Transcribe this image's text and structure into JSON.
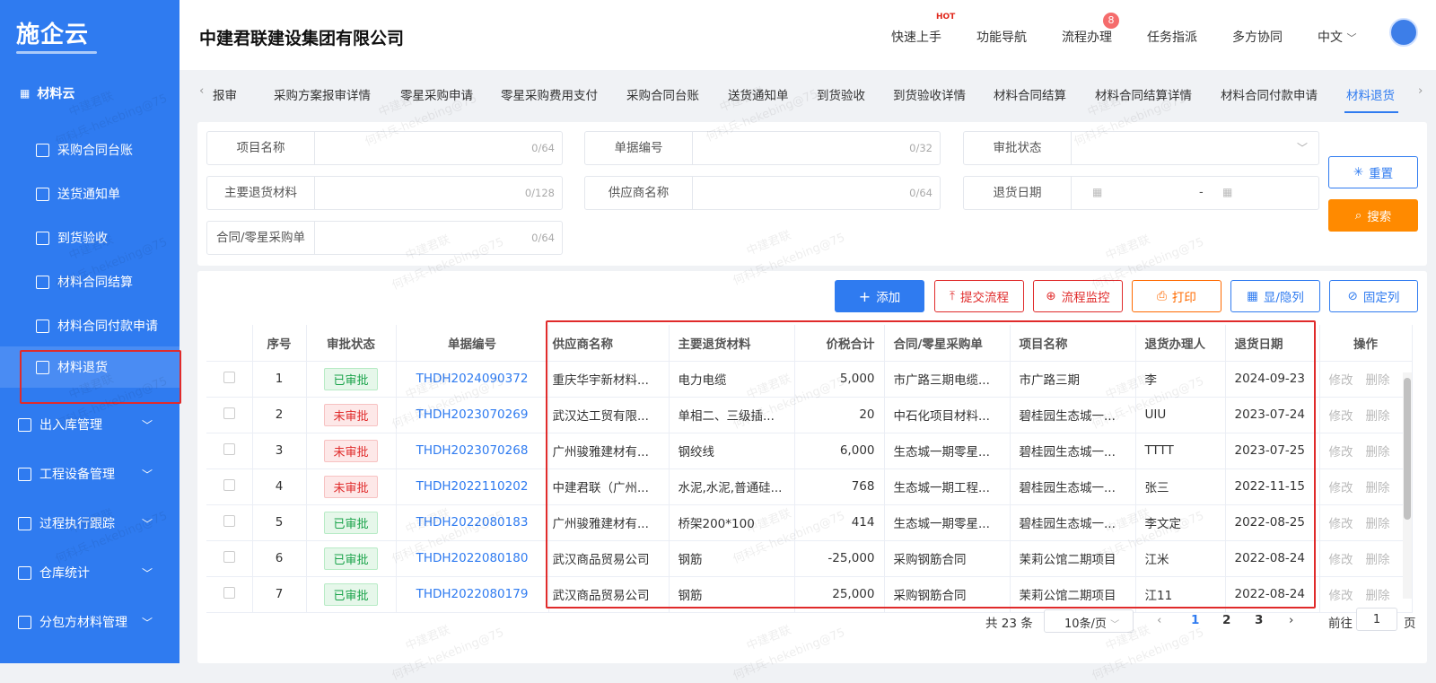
{
  "logo": "施企云",
  "sidebar": {
    "group": "材料云",
    "items": [
      {
        "label": "采购合同台账"
      },
      {
        "label": "送货通知单"
      },
      {
        "label": "到货验收"
      },
      {
        "label": "材料合同结算"
      },
      {
        "label": "材料合同付款申请"
      },
      {
        "label": "材料退货"
      }
    ],
    "menus": [
      {
        "label": "出入库管理"
      },
      {
        "label": "工程设备管理"
      },
      {
        "label": "过程执行跟踪"
      },
      {
        "label": "仓库统计"
      },
      {
        "label": "分包方材料管理"
      }
    ]
  },
  "header": {
    "company": "中建君联建设集团有限公司",
    "nav": [
      "快速上手",
      "功能导航",
      "流程办理",
      "任务指派",
      "多方协同",
      "中文"
    ],
    "hot": "HOT",
    "badge": "8"
  },
  "tabs": [
    "报审",
    "采购方案报审详情",
    "零星采购申请",
    "零星采购费用支付",
    "采购合同台账",
    "送货通知单",
    "到货验收",
    "到货验收详情",
    "材料合同结算",
    "材料合同结算详情",
    "材料合同付款申请",
    "材料退货"
  ],
  "filters": {
    "project_name": {
      "label": "项目名称",
      "count": "0/64"
    },
    "doc_no": {
      "label": "单据编号",
      "count": "0/32"
    },
    "approval": {
      "label": "审批状态"
    },
    "material": {
      "label": "主要退货材料",
      "count": "0/128"
    },
    "supplier": {
      "label": "供应商名称",
      "count": "0/64"
    },
    "return_date": {
      "label": "退货日期",
      "sep": "-"
    },
    "contract": {
      "label": "合同/零星采购单",
      "count": "0/64"
    }
  },
  "actions": {
    "reset": "重置",
    "search": "搜索",
    "add": "添加",
    "submit": "提交流程",
    "monitor": "流程监控",
    "print": "打印",
    "toggle_cols": "显/隐列",
    "fix_cols": "固定列"
  },
  "table": {
    "headers": [
      "序号",
      "审批状态",
      "单据编号",
      "供应商名称",
      "主要退货材料",
      "价税合计",
      "合同/零星采购单",
      "项目名称",
      "退货办理人",
      "退货日期",
      "操作"
    ],
    "op_edit": "修改",
    "op_delete": "删除",
    "rows": [
      {
        "no": "1",
        "status": "已审批",
        "ok": true,
        "code": "THDH2024090372",
        "supplier": "重庆华宇新材料...",
        "material": "电力电缆",
        "amount": "5,000",
        "contract": "市广路三期电缆...",
        "project": "市广路三期",
        "handler": "李",
        "date": "2024-09-23"
      },
      {
        "no": "2",
        "status": "未审批",
        "ok": false,
        "code": "THDH2023070269",
        "supplier": "武汉达工贸有限...",
        "material": "单相二、三级插...",
        "amount": "20",
        "contract": "中石化项目材料...",
        "project": "碧桂园生态城一...",
        "handler": "UIU",
        "date": "2023-07-24"
      },
      {
        "no": "3",
        "status": "未审批",
        "ok": false,
        "code": "THDH2023070268",
        "supplier": "广州骏雅建材有...",
        "material": "钢绞线",
        "amount": "6,000",
        "contract": "生态城一期零星...",
        "project": "碧桂园生态城一...",
        "handler": "TTTT",
        "date": "2023-07-25"
      },
      {
        "no": "4",
        "status": "未审批",
        "ok": false,
        "code": "THDH2022110202",
        "supplier": "中建君联（广州...",
        "material": "水泥,水泥,普通硅...",
        "amount": "768",
        "contract": "生态城一期工程...",
        "project": "碧桂园生态城一...",
        "handler": "张三",
        "date": "2022-11-15"
      },
      {
        "no": "5",
        "status": "已审批",
        "ok": true,
        "code": "THDH2022080183",
        "supplier": "广州骏雅建材有...",
        "material": "桥架200*100",
        "amount": "414",
        "contract": "生态城一期零星...",
        "project": "碧桂园生态城一...",
        "handler": "李文定",
        "date": "2022-08-25"
      },
      {
        "no": "6",
        "status": "已审批",
        "ok": true,
        "code": "THDH2022080180",
        "supplier": "武汉商品贸易公司",
        "material": "钢筋",
        "amount": "-25,000",
        "contract": "采购钢筋合同",
        "project": "茉莉公馆二期项目",
        "handler": "江米",
        "date": "2022-08-24"
      },
      {
        "no": "7",
        "status": "已审批",
        "ok": true,
        "code": "THDH2022080179",
        "supplier": "武汉商品贸易公司",
        "material": "钢筋",
        "amount": "25,000",
        "contract": "采购钢筋合同",
        "project": "茉莉公馆二期项目",
        "handler": "江11",
        "date": "2022-08-24"
      }
    ]
  },
  "pagination": {
    "total": "共 23 条",
    "size": "10条/页",
    "pages": [
      "1",
      "2",
      "3"
    ],
    "goto": "前往",
    "goto_value": "1",
    "page_suffix": "页"
  },
  "watermark": [
    "中建君联",
    "何科兵-hekebing@75"
  ],
  "colors": {
    "primary": "#2f7bf0",
    "orange": "#ff8a00",
    "danger": "#e02b2b",
    "success": "#1aa34a"
  }
}
